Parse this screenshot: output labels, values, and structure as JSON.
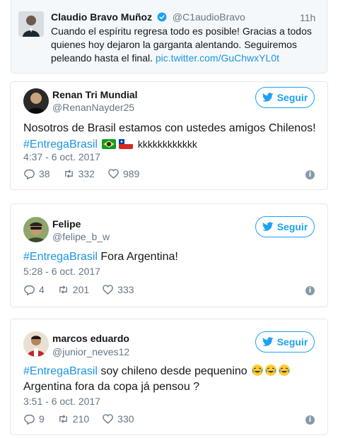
{
  "quoted_tweet": {
    "name": "Claudio Bravo Muñoz",
    "handle": "@C1audioBravo",
    "time": "11h",
    "text": "Cuando el espíritu regresa todo es posible! Gracias a todos quienes hoy dejaron la garganta alentando. Seguiremos peleando hasta el final.",
    "link": "pic.twitter.com/GuChwxYL0t"
  },
  "follow_label": "Seguir",
  "tweets": [
    {
      "name": "Renan Tri Mundial",
      "handle": "@RenanNayder25",
      "line1": "Nosotros de Brasil estamos con ustedes amigos Chilenos!",
      "hashtag": "#EntregaBrasil",
      "tail": "kkkkkkkkkkkk",
      "date": "4:37 - 6 oct. 2017",
      "replies": "38",
      "retweets": "332",
      "likes": "989"
    },
    {
      "name": "Felipe",
      "handle": "@felipe_b_w",
      "hashtag": "#EntregaBrasil",
      "tail": "Fora Argentina!",
      "date": "5:28 - 6 oct. 2017",
      "replies": "4",
      "retweets": "201",
      "likes": "333"
    },
    {
      "name": "marcos eduardo",
      "handle": "@junior_neves12",
      "hashtag": "#EntregaBrasil",
      "tail": "soy chileno desde pequenino",
      "line2": "Argentina fora da copa já pensou ?",
      "date": "3:51 - 6 oct. 2017",
      "replies": "9",
      "retweets": "210",
      "likes": "330"
    }
  ],
  "colors": {
    "accent": "#1da1f2",
    "link": "#1b95e0",
    "muted": "#657786",
    "border": "#e1e8ed"
  }
}
